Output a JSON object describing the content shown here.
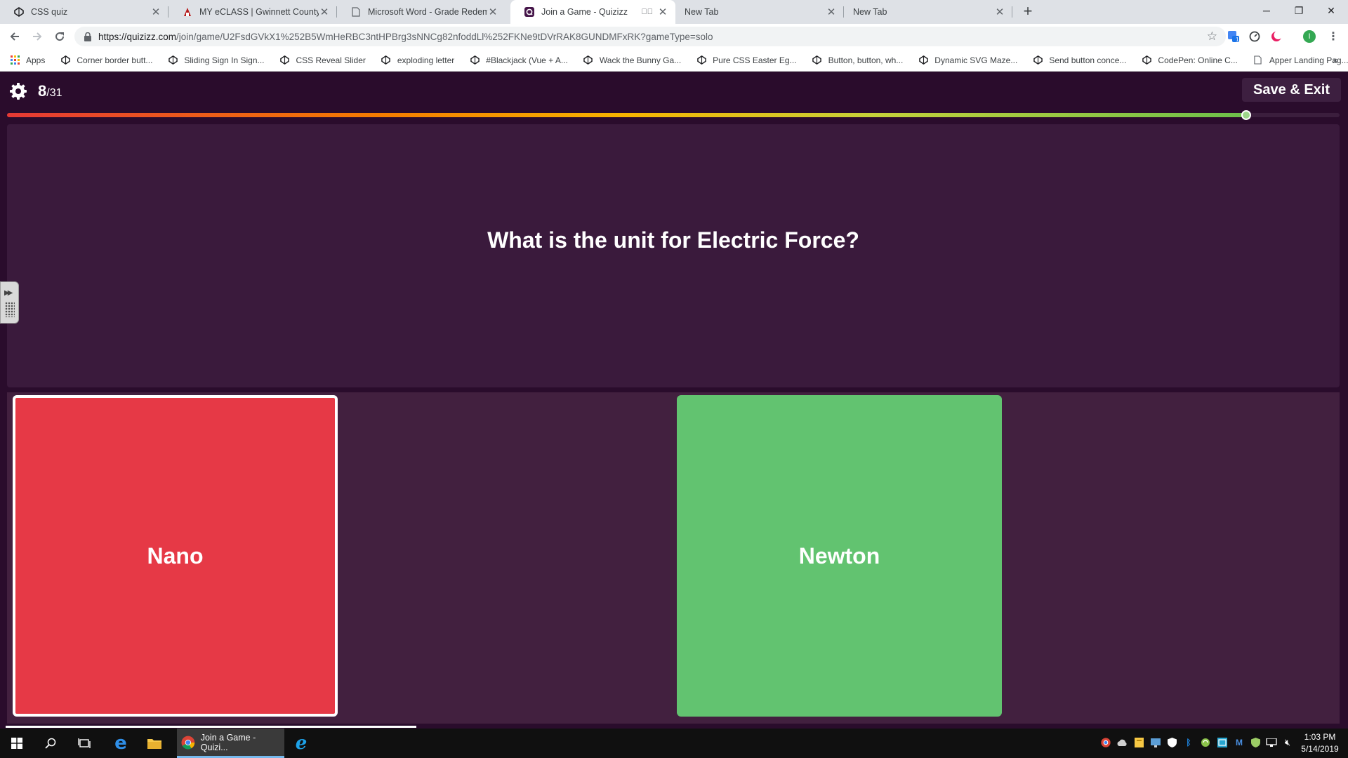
{
  "browser": {
    "tabs": [
      {
        "title": "CSS quiz",
        "icon": "codepen-icon",
        "active": false
      },
      {
        "title": "MY eCLASS | Gwinnett County Pu",
        "icon": "eclass-icon",
        "active": false
      },
      {
        "title": "Microsoft Word - Grade Redemp",
        "icon": "document-icon",
        "active": false
      },
      {
        "title": "Join a Game - Quizizz",
        "icon": "quizizz-icon",
        "active": true,
        "muted": true
      },
      {
        "title": "New Tab",
        "icon": "",
        "active": false
      },
      {
        "title": "New Tab",
        "icon": "",
        "active": false
      }
    ],
    "url_host": "https://quizizz.com",
    "url_path": "/join/game/U2FsdGVkX1%252B5WmHeRBC3ntHPBrg3sNNCg82nfoddLl%252FKNe9tDVrRAK8GUNDMFxRK?gameType=solo",
    "profile_initial": "I",
    "extension_badge": "1",
    "bookmarks": [
      {
        "label": "Apps",
        "icon": "apps-grid-icon"
      },
      {
        "label": "Corner border butt...",
        "icon": "codepen-icon"
      },
      {
        "label": "Sliding Sign In Sign...",
        "icon": "codepen-icon"
      },
      {
        "label": "CSS Reveal Slider",
        "icon": "codepen-icon"
      },
      {
        "label": "exploding letter",
        "icon": "codepen-icon"
      },
      {
        "label": "#Blackjack (Vue + A...",
        "icon": "codepen-icon"
      },
      {
        "label": "Wack the Bunny Ga...",
        "icon": "codepen-icon"
      },
      {
        "label": "Pure CSS Easter Eg...",
        "icon": "codepen-icon"
      },
      {
        "label": "Button, button, wh...",
        "icon": "codepen-icon"
      },
      {
        "label": "Dynamic SVG Maze...",
        "icon": "codepen-icon"
      },
      {
        "label": "Send button conce...",
        "icon": "codepen-icon"
      },
      {
        "label": "CodePen: Online C...",
        "icon": "codepen-icon"
      },
      {
        "label": "Apper Landing Pag...",
        "icon": "document-icon"
      }
    ],
    "bookmarks_more": "»"
  },
  "quiz": {
    "current_question": "8",
    "total_questions": "/31",
    "save_exit_label": "Save & Exit",
    "progress_fraction": 0.93,
    "question": "What is the unit for Electric Force?",
    "answers": [
      {
        "text": "Nano",
        "state": "incorrect-selected",
        "color": "#e63946"
      },
      {
        "text": "Newton",
        "state": "correct",
        "color": "#62c370"
      }
    ],
    "colors": {
      "background": "#2a0c2c",
      "question_panel": "#3a1a3c",
      "answer_area": "#42203f"
    }
  },
  "taskbar": {
    "active_app_label": "Join a Game - Quizi...",
    "time": "1:03 PM",
    "date": "5/14/2019"
  }
}
